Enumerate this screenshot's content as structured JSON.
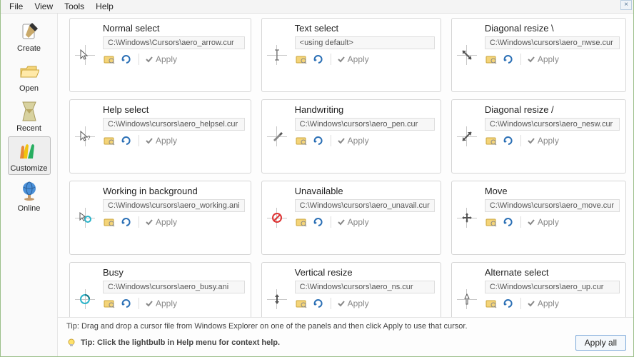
{
  "menu": {
    "file": "File",
    "view": "View",
    "tools": "Tools",
    "help": "Help"
  },
  "close": "×",
  "sidebar": {
    "items": [
      {
        "label": "Create"
      },
      {
        "label": "Open"
      },
      {
        "label": "Recent"
      },
      {
        "label": "Customize"
      },
      {
        "label": "Online"
      }
    ]
  },
  "panels": [
    {
      "title": "Normal select",
      "path": "C:\\Windows\\Cursors\\aero_arrow.cur",
      "apply": "Apply"
    },
    {
      "title": "Text select",
      "path": "<using default>",
      "apply": "Apply"
    },
    {
      "title": "Diagonal resize \\",
      "path": "C:\\Windows\\cursors\\aero_nwse.cur",
      "apply": "Apply"
    },
    {
      "title": "Help select",
      "path": "C:\\Windows\\cursors\\aero_helpsel.cur",
      "apply": "Apply"
    },
    {
      "title": "Handwriting",
      "path": "C:\\Windows\\cursors\\aero_pen.cur",
      "apply": "Apply"
    },
    {
      "title": "Diagonal resize /",
      "path": "C:\\Windows\\cursors\\aero_nesw.cur",
      "apply": "Apply"
    },
    {
      "title": "Working in background",
      "path": "C:\\Windows\\cursors\\aero_working.ani",
      "apply": "Apply"
    },
    {
      "title": "Unavailable",
      "path": "C:\\Windows\\cursors\\aero_unavail.cur",
      "apply": "Apply"
    },
    {
      "title": "Move",
      "path": "C:\\Windows\\cursors\\aero_move.cur",
      "apply": "Apply"
    },
    {
      "title": "Busy",
      "path": "C:\\Windows\\cursors\\aero_busy.ani",
      "apply": "Apply"
    },
    {
      "title": "Vertical resize",
      "path": "C:\\Windows\\cursors\\aero_ns.cur",
      "apply": "Apply"
    },
    {
      "title": "Alternate select",
      "path": "C:\\Windows\\cursors\\aero_up.cur",
      "apply": "Apply"
    }
  ],
  "footer": {
    "tip1": "Tip: Drag and drop a cursor file from Windows Explorer on one of the panels and then click Apply to use that cursor.",
    "tip2_prefix": "Tip: ",
    "tip2_bold": "Click the lightbulb in Help menu for context help.",
    "apply_all": "Apply all"
  }
}
